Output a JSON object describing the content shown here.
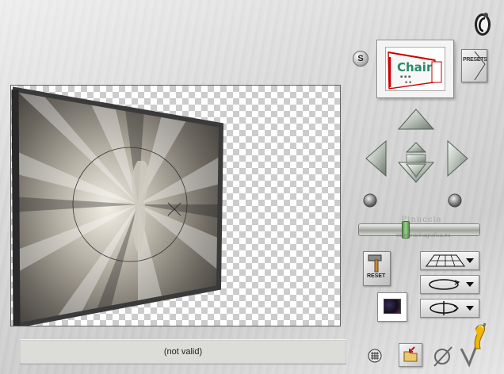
{
  "status": {
    "text": "(not valid)"
  },
  "thumbnail": {
    "text": "Chair",
    "icon": "thumbnail-preview"
  },
  "presets": {
    "label": "PRESETS"
  },
  "s_badge": {
    "label": "S"
  },
  "reset": {
    "label": "RESET"
  },
  "slider": {
    "watermark": "Pinuccia",
    "watermark_sub": "www.marinagrafica.eu",
    "value": 0.38
  },
  "icons": {
    "top_right": "corel-logo-icon",
    "grid": "grid-icon",
    "open": "open-folder-icon",
    "cancel": "cancel-icon",
    "ok": "ok-check-icon",
    "perspective": "perspective-plane-icon",
    "rotate": "rotate-loop-icon",
    "flip": "flip-rotate-icon",
    "color": "color-swatch-icon"
  },
  "colors": {
    "accent_green": "#6aa65a",
    "arrow_fill": "#c5ccc5"
  }
}
